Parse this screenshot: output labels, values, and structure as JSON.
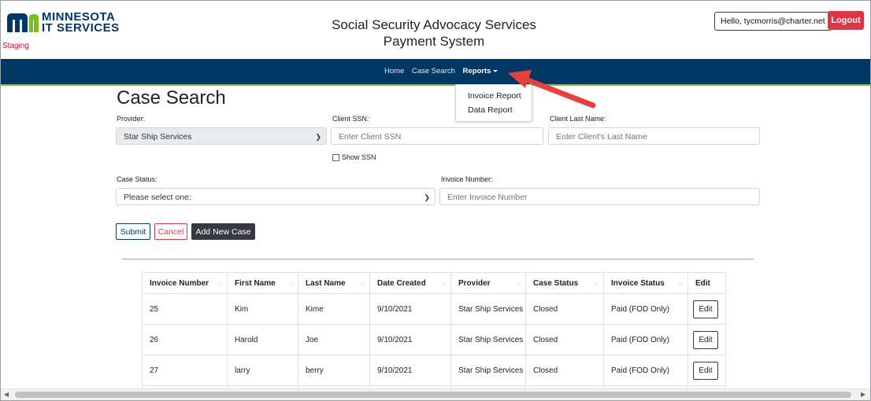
{
  "header": {
    "logo_line1": "MINNESOTA",
    "logo_line2": "IT SERVICES",
    "staging": "Staging",
    "title_line1": "Social Security Advocacy Services",
    "title_line2": "Payment System",
    "hello": "Hello, tycmorris@charter.net",
    "logout": "Logout"
  },
  "nav": {
    "home": "Home",
    "case_search": "Case Search",
    "reports": "Reports"
  },
  "reports_menu": [
    "Invoice Report",
    "Data Report"
  ],
  "form": {
    "title": "Case Search",
    "provider_label": "Provider:",
    "provider_value": "Star Ship Services",
    "ssn_label": "Client SSN:",
    "ssn_placeholder": "Enter Client SSN",
    "show_ssn": "Show SSN",
    "lastname_label": "Client Last Name:",
    "lastname_placeholder": "Enter Client's Last Name",
    "status_label": "Case Status:",
    "status_value": "Please select one:",
    "invoice_label": "Invoice Number:",
    "invoice_placeholder": "Enter Invoice Number",
    "submit": "Submit",
    "cancel": "Cancel",
    "add_new": "Add New Case"
  },
  "table": {
    "headers": [
      "Invoice Number",
      "First Name",
      "Last Name",
      "Date Created",
      "Provider",
      "Case Status",
      "Invoice Status",
      "Edit"
    ],
    "rows": [
      [
        "25",
        "Kim",
        "Kime",
        "9/10/2021",
        "Star Ship Services",
        "Closed",
        "Paid (FOD Only)",
        "Edit"
      ],
      [
        "26",
        "Harold",
        "Joe",
        "9/10/2021",
        "Star Ship Services",
        "Closed",
        "Paid (FOD Only)",
        "Edit"
      ],
      [
        "27",
        "larry",
        "berry",
        "9/10/2021",
        "Star Ship Services",
        "Closed",
        "Paid (FOD Only)",
        "Edit"
      ],
      [
        "",
        "",
        "",
        "",
        "",
        "",
        "",
        ""
      ]
    ]
  },
  "colors": {
    "navy": "#003865",
    "green_accent": "#78be20",
    "logout_red": "#dc3545",
    "annotation_arrow": "#e8413b"
  }
}
